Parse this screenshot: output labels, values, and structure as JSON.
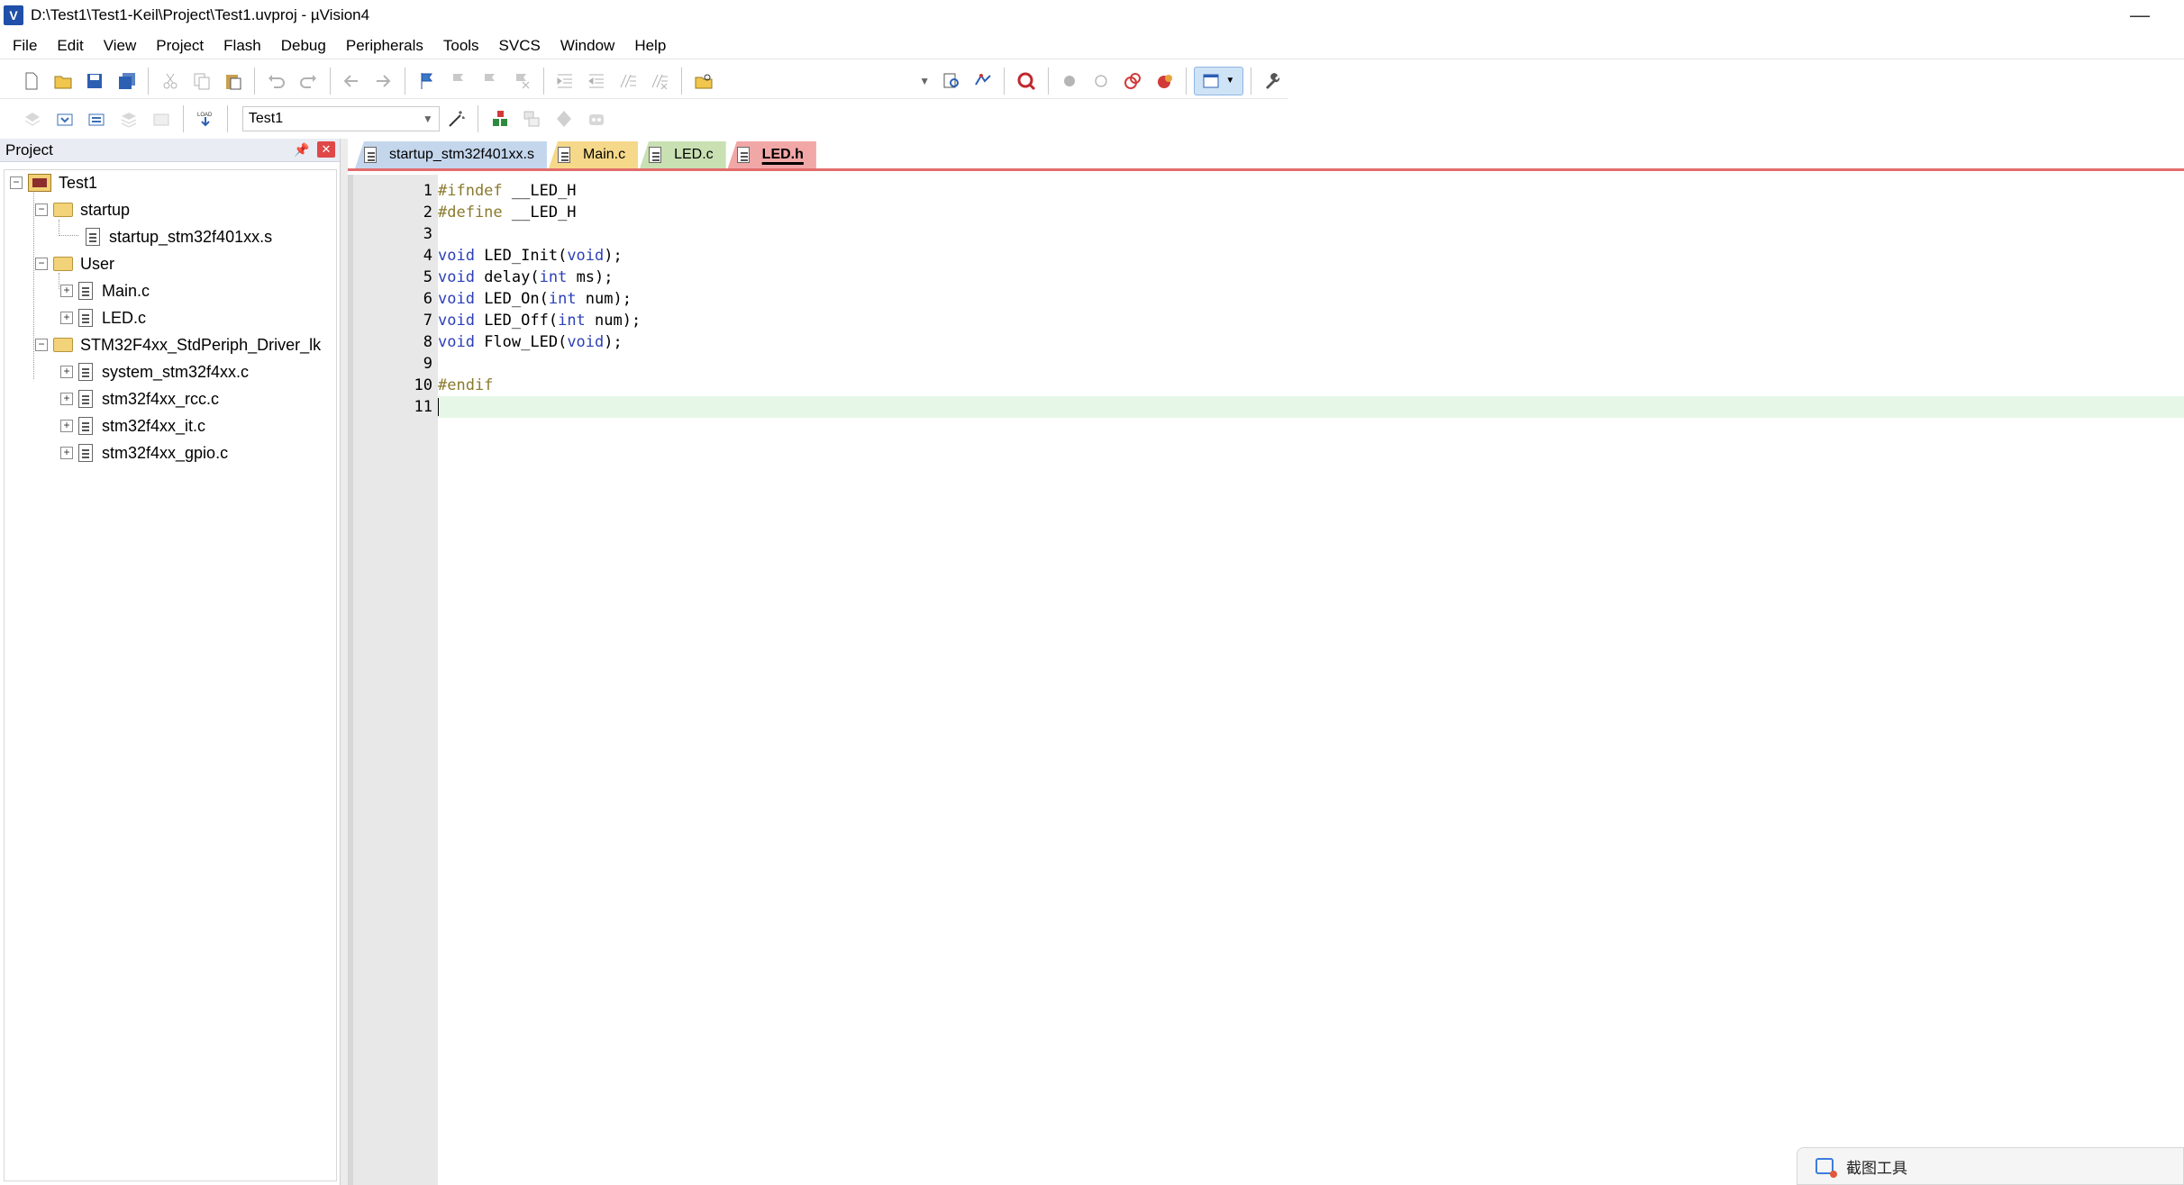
{
  "window": {
    "title": "D:\\Test1\\Test1-Keil\\Project\\Test1.uvproj - µVision4",
    "app_icon": "V",
    "minimize_glyph": "—"
  },
  "menu": [
    "File",
    "Edit",
    "View",
    "Project",
    "Flash",
    "Debug",
    "Peripherals",
    "Tools",
    "SVCS",
    "Window",
    "Help"
  ],
  "toolbar2": {
    "target": "Test1",
    "load_icon_text": "LOAD"
  },
  "project_panel": {
    "title": "Project",
    "pin_glyph": "📌",
    "close_glyph": "✕",
    "tree": {
      "root": "Test1",
      "groups": [
        {
          "name": "startup",
          "files": [
            "startup_stm32f401xx.s"
          ]
        },
        {
          "name": "User",
          "files": [
            "Main.c",
            "LED.c"
          ]
        },
        {
          "name": "STM32F4xx_StdPeriph_Driver_lk",
          "files": [
            "system_stm32f4xx.c",
            "stm32f4xx_rcc.c",
            "stm32f4xx_it.c",
            "stm32f4xx_gpio.c"
          ]
        }
      ]
    }
  },
  "tabs": [
    {
      "label": "startup_stm32f401xx.s",
      "active": false
    },
    {
      "label": "Main.c",
      "active": false
    },
    {
      "label": "LED.c",
      "active": false
    },
    {
      "label": "LED.h",
      "active": true
    }
  ],
  "editor": {
    "current_line": 11,
    "lines": [
      {
        "n": "1",
        "tokens": [
          {
            "c": "pp",
            "t": "#ifndef"
          },
          {
            "c": "txt",
            "t": " __LED_H"
          }
        ]
      },
      {
        "n": "2",
        "tokens": [
          {
            "c": "pp",
            "t": "#define"
          },
          {
            "c": "txt",
            "t": " __LED_H"
          }
        ]
      },
      {
        "n": "3",
        "tokens": []
      },
      {
        "n": "4",
        "tokens": [
          {
            "c": "kw",
            "t": "void"
          },
          {
            "c": "txt",
            "t": " LED_Init("
          },
          {
            "c": "kw",
            "t": "void"
          },
          {
            "c": "txt",
            "t": ");"
          }
        ]
      },
      {
        "n": "5",
        "tokens": [
          {
            "c": "kw",
            "t": "void"
          },
          {
            "c": "txt",
            "t": " delay("
          },
          {
            "c": "kw",
            "t": "int"
          },
          {
            "c": "txt",
            "t": " ms);"
          }
        ]
      },
      {
        "n": "6",
        "tokens": [
          {
            "c": "kw",
            "t": "void"
          },
          {
            "c": "txt",
            "t": " LED_On("
          },
          {
            "c": "kw",
            "t": "int"
          },
          {
            "c": "txt",
            "t": " num);"
          }
        ]
      },
      {
        "n": "7",
        "tokens": [
          {
            "c": "kw",
            "t": "void"
          },
          {
            "c": "txt",
            "t": " LED_Off("
          },
          {
            "c": "kw",
            "t": "int"
          },
          {
            "c": "txt",
            "t": " num);"
          }
        ]
      },
      {
        "n": "8",
        "tokens": [
          {
            "c": "kw",
            "t": "void"
          },
          {
            "c": "txt",
            "t": " Flow_LED("
          },
          {
            "c": "kw",
            "t": "void"
          },
          {
            "c": "txt",
            "t": ");"
          }
        ]
      },
      {
        "n": "9",
        "tokens": []
      },
      {
        "n": "10",
        "tokens": [
          {
            "c": "pp",
            "t": "#endif"
          }
        ]
      },
      {
        "n": "11",
        "tokens": []
      }
    ]
  },
  "snipping_tool": {
    "label": "截图工具"
  }
}
